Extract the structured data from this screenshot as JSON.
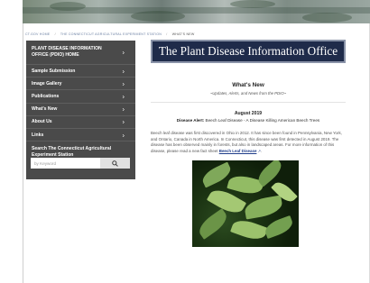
{
  "breadcrumb": {
    "items": [
      "CT.GOV HOME",
      "THE CONNECTICUT AGRICULTURAL EXPERIMENT STATION"
    ],
    "current": "WHAT'S NEW"
  },
  "sidebar": {
    "items": [
      {
        "label": "PLANT DISEASE INFORMATION OFFICE (PDIO) HOME"
      },
      {
        "label": "Sample Submission"
      },
      {
        "label": "Image Gallery"
      },
      {
        "label": "Publications"
      },
      {
        "label": "What's New"
      },
      {
        "label": "About Us"
      },
      {
        "label": "Links"
      }
    ],
    "chevron": "›",
    "search_title": "Search The Connecticut Agricultural Experiment Station",
    "search_placeholder": "by Keyword"
  },
  "header": {
    "title": "The Plant Disease Information Office"
  },
  "main": {
    "heading": "What's New",
    "tagline": "~Updates, Alerts, and News from the PDIO~",
    "date": "August 2019",
    "alert_label": "Disease Alert:",
    "alert_text": "Beech Leaf Disease - A Disease Killing American Beech Trees",
    "paragraph": "Beech leaf disease was first discovered in Ohio in 2012. It has since been found in Pennsylvania, New York, and Ontario, Canada in North America. In Connecticut, this disease was first detected in August 2019. The disease has been observed mainly in forests, but also in landscaped areas. For more information of this disease, please read a new fact sheet",
    "link_text": "Beech Leaf Disease"
  },
  "icons": {
    "search": "search-icon",
    "chevron": "chevron-right-icon",
    "external": "external-link-icon"
  }
}
